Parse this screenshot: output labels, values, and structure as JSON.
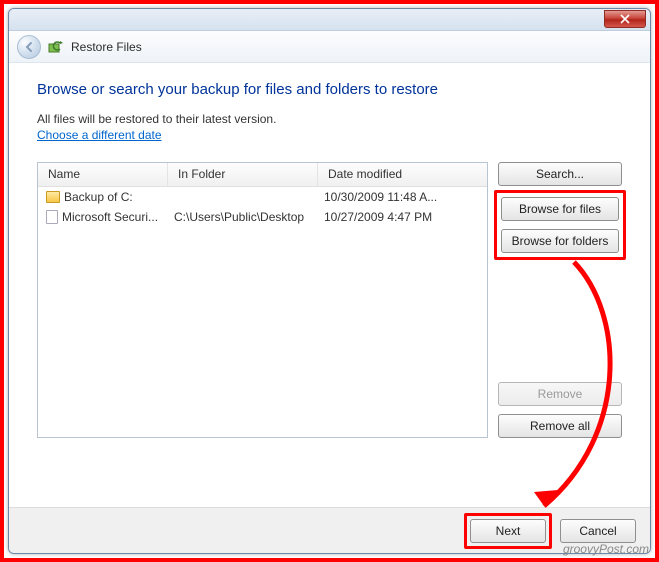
{
  "window": {
    "title": "Restore Files"
  },
  "heading": "Browse or search your backup for files and folders to restore",
  "subtext": "All files will be restored to their latest version.",
  "link": "Choose a different date",
  "columns": {
    "name": "Name",
    "folder": "In Folder",
    "date": "Date modified"
  },
  "rows": [
    {
      "icon": "folder",
      "name": "Backup of C:",
      "folder": "",
      "date": "10/30/2009 11:48 A..."
    },
    {
      "icon": "file",
      "name": "Microsoft Securi...",
      "folder": "C:\\Users\\Public\\Desktop",
      "date": "10/27/2009 4:47 PM"
    }
  ],
  "buttons": {
    "search": "Search...",
    "browse_files": "Browse for files",
    "browse_folders": "Browse for folders",
    "remove": "Remove",
    "remove_all": "Remove all",
    "next": "Next",
    "cancel": "Cancel"
  },
  "watermark": "groovyPost.com"
}
